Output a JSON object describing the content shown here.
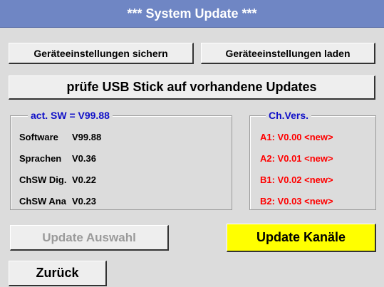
{
  "window": {
    "title": "*** System Update ***"
  },
  "buttons": {
    "save_settings": "Geräteeinstellungen sichern",
    "load_settings": "Geräteeinstellungen laden",
    "check_usb": "prüfe USB Stick auf vorhandene Updates",
    "update_selection": "Update Auswahl",
    "update_channels": "Update Kanäle",
    "back": "Zurück"
  },
  "software_group": {
    "legend": "act. SW = V99.88",
    "rows": [
      {
        "label": "Software",
        "value": "V99.88"
      },
      {
        "label": "Sprachen",
        "value": "V0.36"
      },
      {
        "label": "ChSW Dig.",
        "value": "V0.22"
      },
      {
        "label": "ChSW Ana",
        "value": "V0.23"
      }
    ]
  },
  "channel_group": {
    "legend": "Ch.Vers.",
    "rows": [
      "A1: V0.00 <new>",
      "A2: V0.01 <new>",
      "B1: V0.02 <new>",
      "B2: V0.03 <new>"
    ]
  },
  "colors": {
    "title_bar": "#6f86c4",
    "background": "#dcdcdc",
    "legend_blue": "#1010c8",
    "new_red": "#ff0000",
    "highlight_yellow": "#ffff00"
  }
}
